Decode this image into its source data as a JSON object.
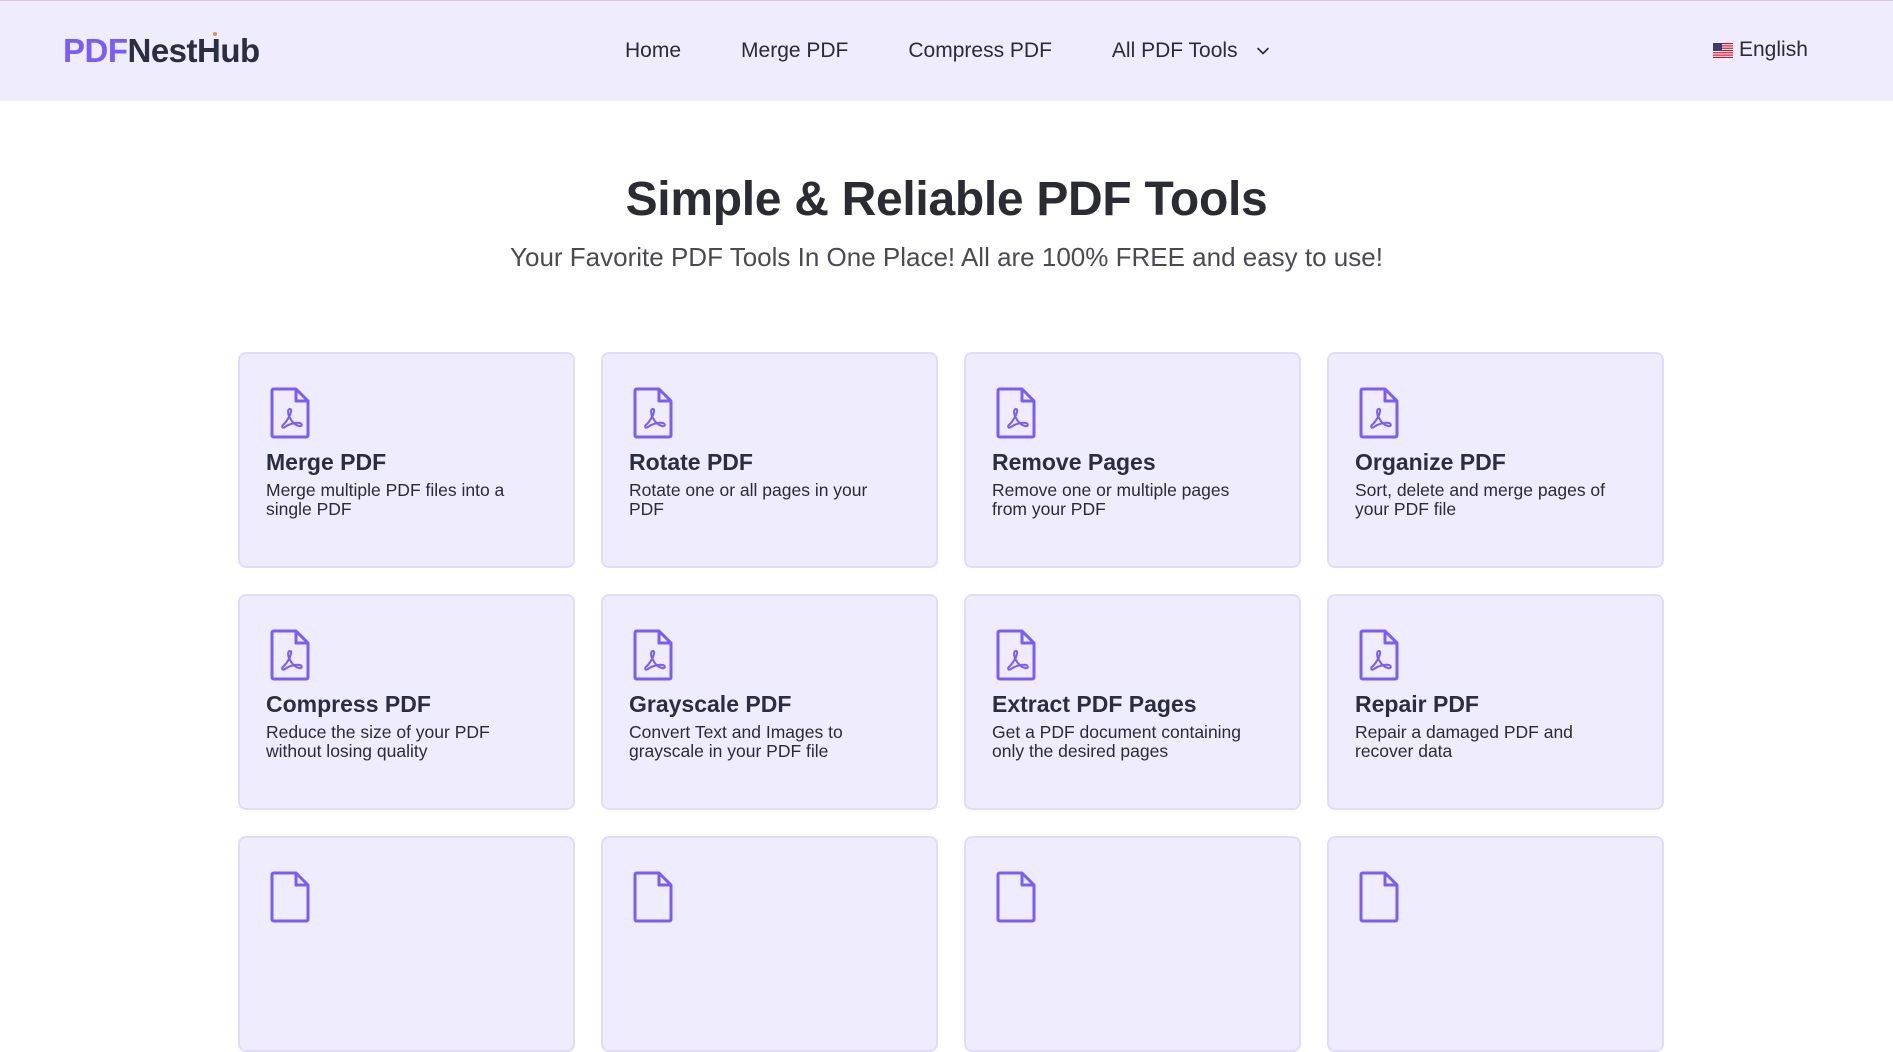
{
  "brand": {
    "logo_part1": "PDF",
    "logo_part2": "NestHub"
  },
  "nav": {
    "items": [
      {
        "label": "Home"
      },
      {
        "label": "Merge PDF"
      },
      {
        "label": "Compress PDF"
      },
      {
        "label": "All PDF Tools"
      }
    ],
    "language": "English"
  },
  "hero": {
    "title": "Simple & Reliable PDF Tools",
    "subtitle": "Your Favorite PDF Tools In One Place! All are 100% FREE and easy to use!"
  },
  "tools": [
    {
      "title": "Merge PDF",
      "desc": "Merge multiple PDF files into a single PDF"
    },
    {
      "title": "Rotate PDF",
      "desc": "Rotate one or all pages in your PDF"
    },
    {
      "title": "Remove Pages",
      "desc": "Remove one or multiple pages from your PDF"
    },
    {
      "title": "Organize PDF",
      "desc": "Sort, delete and merge pages of your PDF file"
    },
    {
      "title": "Compress PDF",
      "desc": "Reduce the size of your PDF without losing quality"
    },
    {
      "title": "Grayscale PDF",
      "desc": "Convert Text and Images to grayscale in your PDF file"
    },
    {
      "title": "Extract PDF Pages",
      "desc": "Get a PDF document containing only the desired pages"
    },
    {
      "title": "Repair PDF",
      "desc": "Repair a damaged PDF and recover data"
    },
    {
      "title": "",
      "desc": ""
    },
    {
      "title": "",
      "desc": ""
    },
    {
      "title": "",
      "desc": ""
    },
    {
      "title": "",
      "desc": ""
    }
  ],
  "colors": {
    "header_bg": "#efecfd",
    "brand_accent": "#7b5cf4",
    "card_bg": "#efecfd",
    "card_border": "#e2dcfa",
    "icon_color": "#7b5cf4"
  },
  "icons": {
    "card_icon": "pdf-file-icon",
    "dropdown": "chevron-down-icon",
    "language": "us-flag-icon"
  }
}
